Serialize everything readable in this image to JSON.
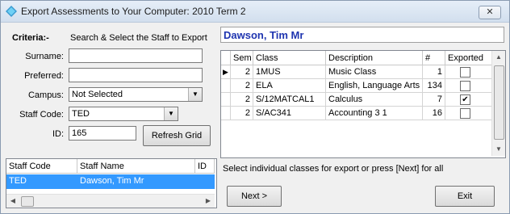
{
  "window": {
    "title": "Export Assessments to Your Computer:  2010 Term 2",
    "close_label": "✕"
  },
  "criteria": {
    "title": "Criteria:-",
    "hint": "Search & Select the Staff to Export",
    "surname_label": "Surname:",
    "surname_value": "",
    "preferred_label": "Preferred:",
    "preferred_value": "",
    "campus_label": "Campus:",
    "campus_value": "Not Selected",
    "staff_code_label": "Staff Code:",
    "staff_code_value": "TED",
    "id_label": "ID:",
    "id_value": "165",
    "refresh_label": "Refresh Grid"
  },
  "staff_grid": {
    "headers": [
      "Staff Code",
      "Staff Name",
      "ID"
    ],
    "rows": [
      {
        "code": "TED",
        "name": "Dawson, Tim Mr",
        "id": ""
      }
    ]
  },
  "teacher_name": "Dawson, Tim Mr",
  "class_grid": {
    "headers": [
      "Sem",
      "Class",
      "Description",
      "#",
      "Exported"
    ],
    "rows": [
      {
        "sem": "2",
        "class": "1MUS",
        "description": "Music Class",
        "count": "1",
        "exported": false
      },
      {
        "sem": "2",
        "class": "ELA",
        "description": "English, Language Arts",
        "count": "134",
        "exported": false
      },
      {
        "sem": "2",
        "class": "S/12MATCAL1",
        "description": "Calculus",
        "count": "7",
        "exported": true
      },
      {
        "sem": "2",
        "class": "S/AC341",
        "description": "Accounting 3 1",
        "count": "16",
        "exported": false
      }
    ]
  },
  "status_text": "Select individual classes for export or press [Next] for all",
  "next_label": "Next >",
  "exit_label": "Exit"
}
